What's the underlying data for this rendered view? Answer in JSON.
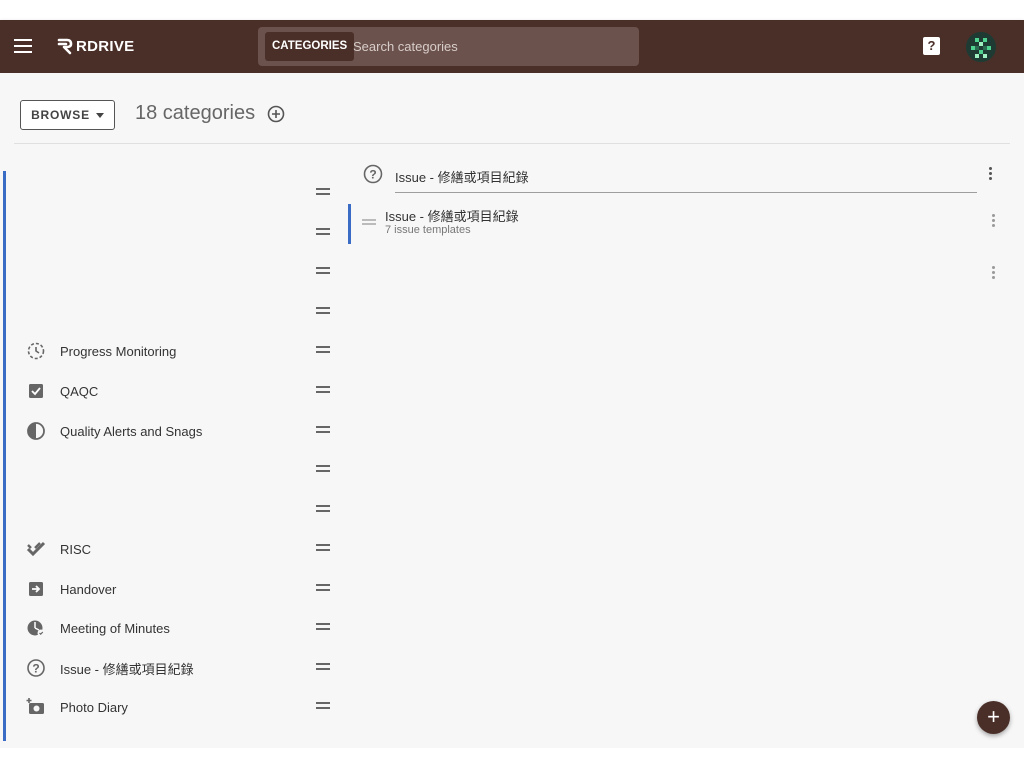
{
  "header": {
    "logo_text": "RDRIVE",
    "search_chip": "CATEGORIES",
    "search_placeholder": "Search categories",
    "help_label": "?",
    "colors": {
      "appbar": "#4a2e28",
      "search_bg": "#6b524d",
      "accent": "#3a6cc6"
    }
  },
  "toolbar": {
    "browse_label": "BROWSE",
    "count_title": "18 categories"
  },
  "categories": [
    {
      "label": "",
      "icon": ""
    },
    {
      "label": "",
      "icon": ""
    },
    {
      "label": "",
      "icon": ""
    },
    {
      "label": "",
      "icon": ""
    },
    {
      "label": "Progress Monitoring",
      "icon": "clock-history-icon"
    },
    {
      "label": "QAQC",
      "icon": "checkbox-icon"
    },
    {
      "label": "Quality Alerts and Snags",
      "icon": "half-circle-icon"
    },
    {
      "label": "",
      "icon": ""
    },
    {
      "label": "",
      "icon": ""
    },
    {
      "label": "RISC",
      "icon": "double-check-icon"
    },
    {
      "label": "Handover",
      "icon": "arrow-box-icon"
    },
    {
      "label": "Meeting of Minutes",
      "icon": "pie-clock-icon"
    },
    {
      "label": "Issue - 修繕或項目紀錄",
      "icon": "question-circle-icon"
    },
    {
      "label": "Photo Diary",
      "icon": "add-camera-icon"
    }
  ],
  "selected_category": {
    "name": "Issue - 修繕或項目紀錄",
    "icon": "question-circle-icon",
    "template_group": {
      "title": "Issue - 修繕或項目紀錄",
      "meta": "7 issue templates"
    }
  },
  "fab_label": "+"
}
